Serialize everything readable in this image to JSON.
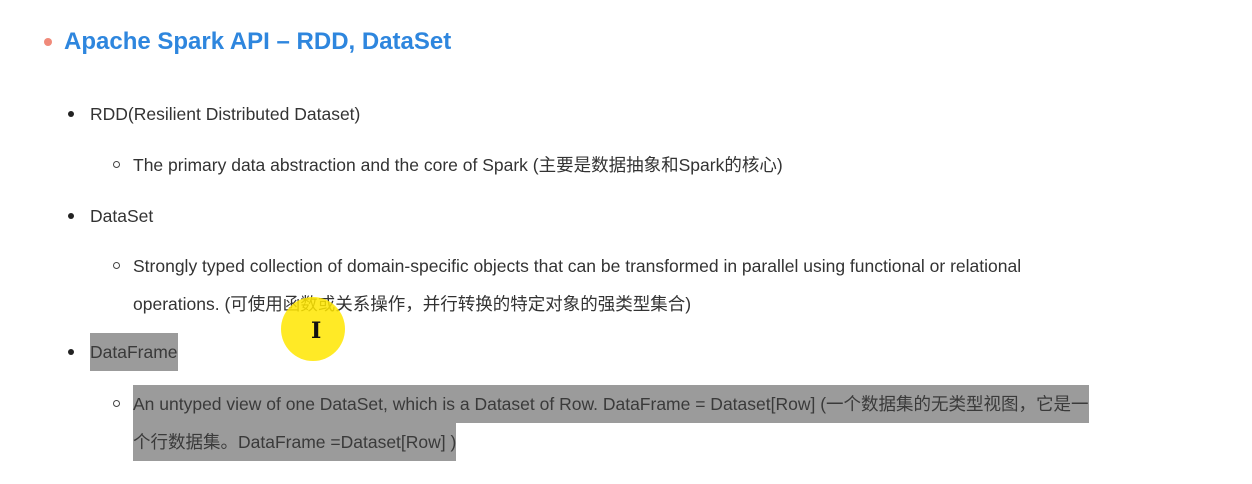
{
  "heading": {
    "title": "Apache Spark API – RDD, DataSet",
    "accent_color": "#2e86de",
    "bullet_color": "#f08a7a"
  },
  "items": [
    {
      "label": "RDD(Resilient Distributed Dataset)",
      "sub": "The primary data abstraction and the core of Spark (主要是数据抽象和Spark的核心)"
    },
    {
      "label": "DataSet",
      "sub_line1": "Strongly typed collection of domain-specific objects that can be transformed in parallel using functional or relational",
      "sub_line2": "operations. (可使用函数或关系操作，并行转换的特定对象的强类型集合)"
    },
    {
      "label": "DataFrame",
      "sub_line1": "An untyped view of one DataSet, which is a Dataset of Row. DataFrame = Dataset[Row] (一个数据集的无类型视图，它是一",
      "sub_line2": "个行数据集。DataFrame =Dataset[Row] )"
    }
  ],
  "selection_color": "#9b9b9b",
  "cursor": {
    "icon": "text-cursor-icon",
    "glyph": "I",
    "highlight_color": "#ffe600"
  }
}
